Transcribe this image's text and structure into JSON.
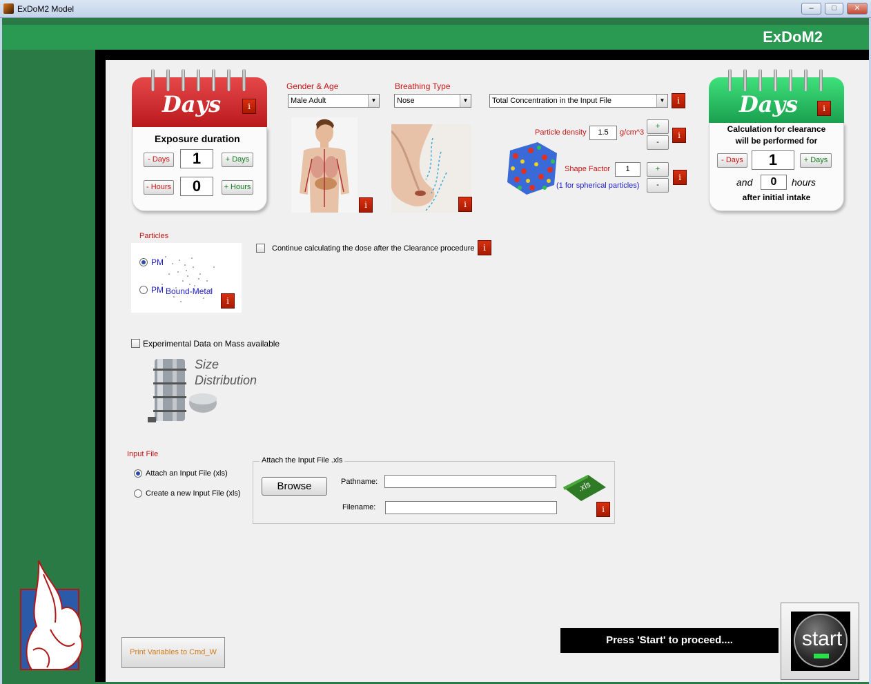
{
  "window": {
    "title": "ExDoM2 Model",
    "minimize": "–",
    "maximize": "□",
    "close": "✕"
  },
  "brand": "ExDoM2",
  "exposure": {
    "days_word": "Days",
    "heading": "Exposure duration",
    "minus_days": "- Days",
    "plus_days": "+ Days",
    "minus_hours": "- Hours",
    "plus_hours": "+ Hours",
    "days_value": "1",
    "hours_value": "0"
  },
  "gender": {
    "label": "Gender & Age",
    "value": "Male Adult"
  },
  "breathing": {
    "label": "Breathing Type",
    "value": "Nose"
  },
  "concentration": {
    "value": "Total Concentration in the Input File"
  },
  "particle": {
    "density_label": "Particle density",
    "density_value": "1.5",
    "density_unit": "g/cm^3",
    "shape_label": "Shape Factor",
    "shape_value": "1",
    "shape_note": "(1 for spherical particles)",
    "plus": "+",
    "minus": "-"
  },
  "clearance": {
    "days_word": "Days",
    "line1": "Calculation for clearance",
    "line2": "will be performed for",
    "minus_days": "- Days",
    "plus_days": "+ Days",
    "days_value": "1",
    "and_word": "and",
    "hours_value": "0",
    "hours_word": "hours",
    "after": "after initial intake"
  },
  "particles": {
    "label": "Particles",
    "opt1": "PM",
    "opt2": "PM",
    "opt2_extra": "Bound-Metal"
  },
  "continue_label": "Continue calculating the dose  after the Clearance procedure",
  "experimental": {
    "label": "Experimental Data on Mass available",
    "caption1": "Size",
    "caption2": "Distribution"
  },
  "input_file": {
    "label": "Input File",
    "opt_attach": "Attach an Input File (xls)",
    "opt_create": "Create a new Input File (xls)",
    "group_title": "Attach the Input File .xls",
    "browse": "Browse",
    "pathname_label": "Pathname:",
    "filename_label": "Filename:",
    "xls": ".xls"
  },
  "info": "i",
  "status": "Press 'Start' to proceed....",
  "start": "start",
  "print_button": "Print Variables to Cmd_W"
}
